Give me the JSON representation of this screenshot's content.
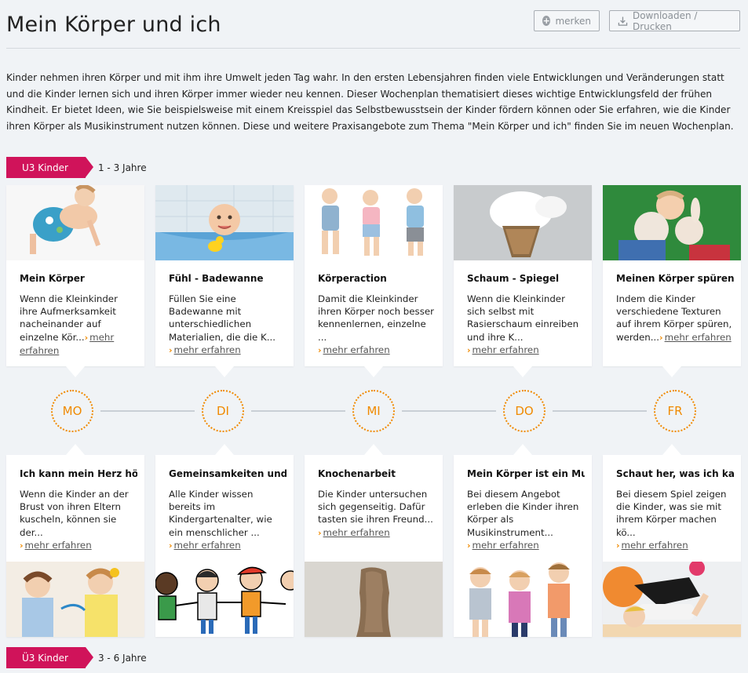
{
  "header": {
    "title": "Mein Körper und ich",
    "merken_label": "merken",
    "download_label": "Downloaden / Drucken"
  },
  "intro": "Kinder nehmen ihren Körper und mit ihm ihre Umwelt jeden Tag wahr. In den ersten Lebensjahren finden viele Entwicklungen und Veränderungen statt und die Kinder lernen sich und ihren Körper immer wieder neu kennen. Dieser Wochenplan thematisiert dieses wichtige Entwicklungsfeld der frühen Kindheit. Er bietet Ideen, wie Sie beispielsweise mit einem Kreisspiel das Selbstbewusstsein der Kinder fördern können oder Sie erfahren, wie die Kinder ihren Körper als Musikinstrument nutzen können. Diese und weitere Praxisangebote zum Thema \"Mein Körper und ich\" finden Sie im neuen Wochenplan.",
  "age_u3": {
    "tag": "U3 Kinder",
    "range": "1 - 3 Jahre"
  },
  "age_u36": {
    "tag": "Ü3 Kinder",
    "range": "3 - 6 Jahre"
  },
  "more_label": "mehr erfahren",
  "days": [
    "MO",
    "DI",
    "MI",
    "DO",
    "FR"
  ],
  "top_cards": [
    {
      "title": "Mein Körper",
      "text": "Wenn die Kleinkinder ihre Aufmerksamkeit nacheinander auf einzelne Kör..."
    },
    {
      "title": "Fühl - Badewanne",
      "text": "Füllen Sie eine Badewanne mit unterschiedlichen Materialien, die die K..."
    },
    {
      "title": "Körperaction",
      "text": "Damit die Kleinkinder ihren Körper noch besser kennenlernen, einzelne ..."
    },
    {
      "title": "Schaum - Spiegel",
      "text": "Wenn die Kleinkinder sich selbst mit Rasierschaum einreiben und ihre K..."
    },
    {
      "title": "Meinen Körper spüren",
      "text": "Indem die Kinder verschiedene Texturen auf ihrem Körper spüren, werden..."
    }
  ],
  "bottom_cards": [
    {
      "title": "Ich kann mein Herz hör...",
      "text": "Wenn die Kinder an der Brust von ihren Eltern kuscheln, können sie der..."
    },
    {
      "title": "Gemeinsamkeiten und ...",
      "text": "Alle Kinder wissen bereits im Kindergartenalter, wie ein menschlicher ..."
    },
    {
      "title": "Knochenarbeit",
      "text": "Die Kinder untersuchen sich gegenseitig. Dafür tasten sie ihren Freund..."
    },
    {
      "title": "Mein Körper ist ein Mu...",
      "text": "Bei diesem Angebot erleben die Kinder ihren Körper als Musikinstrument..."
    },
    {
      "title": "Schaut her, was ich ka...",
      "text": "Bei diesem Spiel zeigen die Kinder, was sie mit ihrem Körper machen kö..."
    }
  ]
}
